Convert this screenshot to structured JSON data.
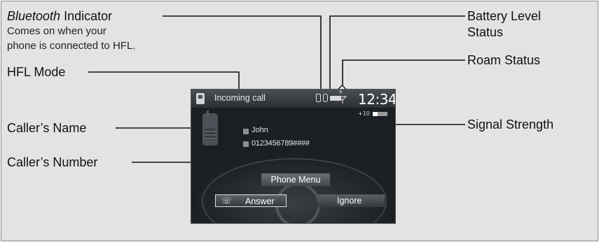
{
  "labels": {
    "bluetooth_title_italic": "Bluetooth",
    "bluetooth_title_rest": " Indicator",
    "bluetooth_desc_line1": "Comes on when your",
    "bluetooth_desc_line2": "phone is connected to HFL.",
    "hfl_mode": "HFL Mode",
    "callers_name": "Caller’s Name",
    "callers_number": "Caller’s Number",
    "battery_level_line1": "Battery Level",
    "battery_level_line2": "Status",
    "roam_status": "Roam Status",
    "signal_strength": "Signal Strength"
  },
  "screen": {
    "header_text": "Incoming call",
    "clock": "12:34",
    "volume_label": "+10",
    "volume_level": 0.33,
    "caller_name": "John",
    "caller_number": "0123456789####",
    "phone_menu_label": "Phone Menu",
    "answer_label": "Answer",
    "ignore_label": "Ignore",
    "roam_text": "R"
  },
  "icons": {
    "phone": "phone-icon",
    "bluetooth": "bluetooth-icon",
    "battery": "battery-icon",
    "roam": "roam-icon",
    "signal": "signal-icon",
    "handset": "handset-icon"
  },
  "colors": {
    "panel_bg": "#e3e3e3",
    "screen_bg": "#1b1e22",
    "callout_line": "#111111"
  }
}
